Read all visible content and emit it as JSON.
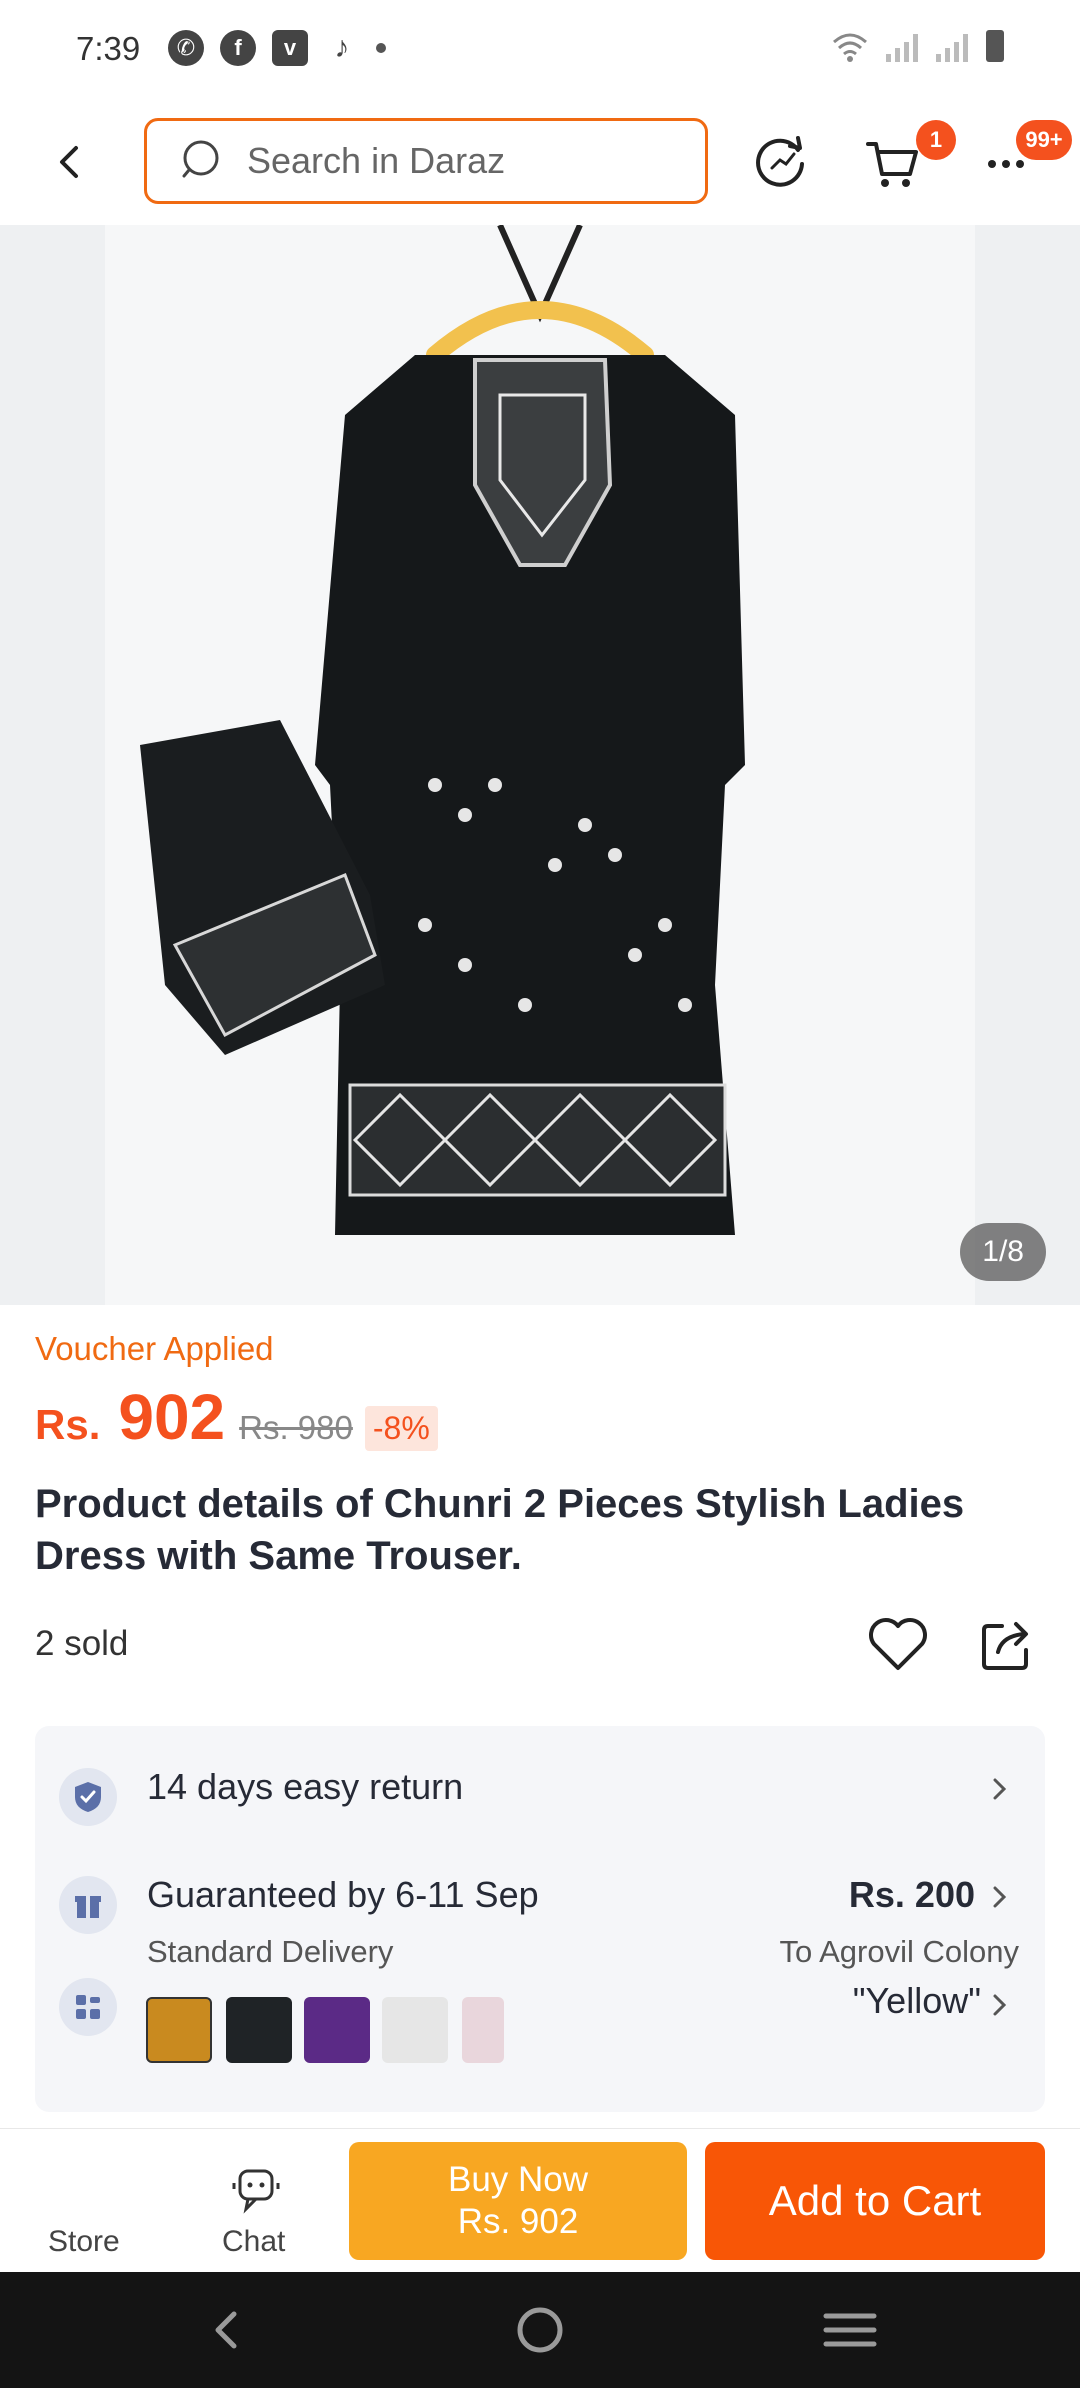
{
  "status_bar": {
    "time": "7:39",
    "left_icons": [
      "whatsapp-icon",
      "facebook-icon",
      "vimeo-icon",
      "tiktok-icon",
      "dot-icon"
    ],
    "right_icons": [
      "wifi-icon",
      "signal-icon",
      "signal-icon",
      "battery-icon"
    ]
  },
  "header": {
    "search_placeholder": "Search in Daraz",
    "cart_count": "1",
    "more_count": "99+"
  },
  "gallery": {
    "counter": "1/8"
  },
  "product": {
    "voucher_label": "Voucher Applied",
    "currency": "Rs.",
    "price": "902",
    "original_price": "Rs. 980",
    "discount": "-8%",
    "title": "Product details of Chunri 2 Pieces Stylish Ladies Dress with Same Trouser.",
    "sold": "2 sold"
  },
  "services": {
    "return": "14 days easy return",
    "delivery_title": "Guaranteed by 6-11 Sep",
    "delivery_type": "Standard Delivery",
    "delivery_fee": "Rs. 200",
    "delivery_location": "To Agrovil Colony",
    "variant_selected": "\"Yellow\"",
    "variant_colors": [
      "#c98a1f",
      "#1f2326",
      "#5b2a86",
      "#e6e6e6",
      "#e9d6dc"
    ]
  },
  "bottom_bar": {
    "store_label": "Store",
    "chat_label": "Chat",
    "buy_now_label": "Buy Now",
    "buy_now_price": "Rs. 902",
    "add_to_cart_label": "Add to Cart"
  },
  "colors": {
    "accent": "#f85606",
    "buy_now": "#f8a722",
    "search_border": "#f06a12"
  }
}
